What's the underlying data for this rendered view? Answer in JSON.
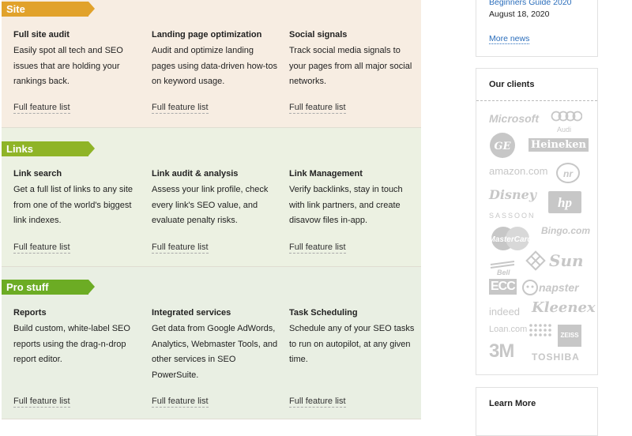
{
  "sections": [
    {
      "tag": "Site",
      "features": [
        {
          "title": "Full site audit",
          "desc": "Easily spot all tech and SEO issues that are holding your rankings back.",
          "link": "Full feature list"
        },
        {
          "title": "Landing page optimization",
          "desc": "Audit and optimize landing pages using data-driven how-tos on keyword usage.",
          "link": "Full feature list"
        },
        {
          "title": "Social signals",
          "desc": "Track social media signals to your pages from all major social networks.",
          "link": "Full feature list"
        }
      ]
    },
    {
      "tag": "Links",
      "features": [
        {
          "title": "Link search",
          "desc": "Get a full list of links to any site from one of the world's biggest link indexes.",
          "link": "Full feature list"
        },
        {
          "title": "Link audit & analysis",
          "desc": "Assess your link profile, check every link's SEO value, and evaluate penalty risks.",
          "link": "Full feature list"
        },
        {
          "title": "Link Management",
          "desc": "Verify backlinks, stay in touch with link partners, and create disavow files in-app.",
          "link": "Full feature list"
        }
      ]
    },
    {
      "tag": "Pro stuff",
      "features": [
        {
          "title": "Reports",
          "desc": "Build custom, white-label SEO reports using the drag-n-drop report editor.",
          "link": "Full feature list"
        },
        {
          "title": "Integrated services",
          "desc": "Get data from Google AdWords, Analytics, Webmaster Tools, and other services in SEO PowerSuite.",
          "link": "Full feature list"
        },
        {
          "title": "Task Scheduling",
          "desc": "Schedule any of your SEO tasks to run on autopilot, at any given time.",
          "link": "Full feature list"
        }
      ]
    }
  ],
  "sidebar": {
    "news": {
      "title": "Beginners Guide 2020",
      "date": "August 18, 2020",
      "more": "More news"
    },
    "clients": {
      "heading": "Our clients",
      "logos": [
        "Microsoft",
        "Audi",
        "GE",
        "Heineken",
        "amazon.com",
        "nr",
        "Disney",
        "hp",
        "SASSOON",
        "MasterCard",
        "Bingo.com",
        "Sun",
        "Bell",
        "ECC",
        "napster",
        "indeed",
        "Kleenex",
        "Loan.com",
        "ZEISS",
        "3M",
        "TOSHIBA"
      ]
    },
    "learn": {
      "heading": "Learn More"
    }
  }
}
